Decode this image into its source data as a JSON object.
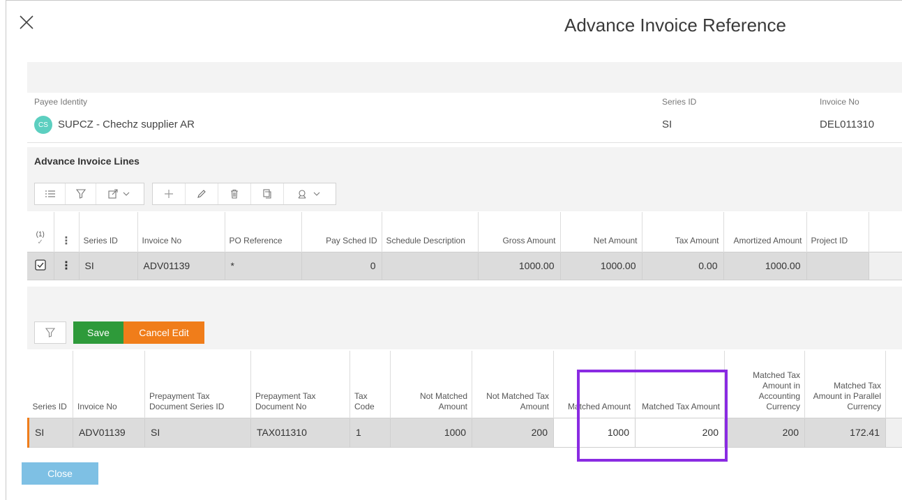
{
  "dialog": {
    "title": "Advance Invoice Reference"
  },
  "header": {
    "payee_label": "Payee Identity",
    "avatar_initials": "CS",
    "payee_value": "SUPCZ - Chechz supplier AR",
    "series_label": "Series ID",
    "series_value": "SI",
    "invoice_label": "Invoice No",
    "invoice_value": "DEL011310"
  },
  "lines": {
    "title": "Advance Invoice Lines",
    "selection_count": "(1)",
    "columns": [
      "Series ID",
      "Invoice No",
      "PO Reference",
      "Pay Sched ID",
      "Schedule Description",
      "Gross Amount",
      "Net Amount",
      "Tax Amount",
      "Amortized Amount",
      "Project ID"
    ],
    "rows": [
      {
        "series_id": "SI",
        "invoice_no": "ADV01139",
        "po_reference": "*",
        "pay_sched_id": "0",
        "schedule_description": "",
        "gross_amount": "1000.00",
        "net_amount": "1000.00",
        "tax_amount": "0.00",
        "amortized_amount": "1000.00",
        "project_id": ""
      }
    ]
  },
  "matching": {
    "save_label": "Save",
    "cancel_label": "Cancel Edit",
    "columns": [
      "Series ID",
      "Invoice No",
      "Prepayment Tax Document Series ID",
      "Prepayment Tax Document No",
      "Tax Code",
      "Not Matched Amount",
      "Not Matched Tax Amount",
      "Matched Amount",
      "Matched Tax Amount",
      "Matched Tax Amount in Accounting Currency",
      "Matched Tax Amount in Parallel Currency"
    ],
    "rows": [
      {
        "series_id": "SI",
        "invoice_no": "ADV01139",
        "prep_series_id": "SI",
        "prep_doc_no": "TAX011310",
        "tax_code": "1",
        "not_matched_amount": "1000",
        "not_matched_tax_amount": "200",
        "matched_amount": "1000",
        "matched_tax_amount": "200",
        "matched_tax_acc": "200",
        "matched_tax_par": "172.41"
      }
    ]
  },
  "footer": {
    "close_label": "Close"
  },
  "colors": {
    "save": "#2e9a3a",
    "cancel": "#f07d1a",
    "close": "#7ec0e4",
    "highlight": "#8a2be2",
    "avatar": "#5ccfc0"
  }
}
